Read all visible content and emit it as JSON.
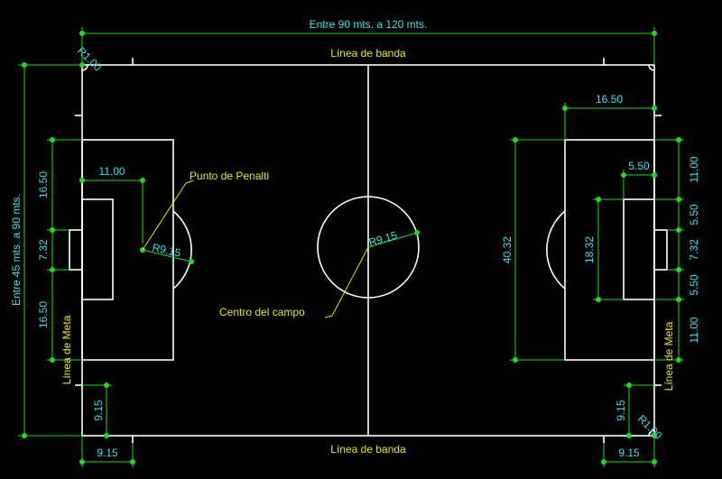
{
  "dimensions": {
    "length_range": "Entre 90 mts. a 120 mts.",
    "width_range": "Entre 45 mts. a 90 mts.",
    "penalty_area_depth": "16.50",
    "penalty_mark_distance": "11.00",
    "goal_width": "7.32",
    "goal_area_depth": "5.50",
    "goal_area_width": "18.32",
    "penalty_area_width": "40.32",
    "corner_radius": "R1.00",
    "arc_radius": "R9.15",
    "center_radius": "R9.15",
    "corner_distance": "9.15"
  },
  "labels": {
    "touchline": "Línea de banda",
    "goal_line": "Línea de Meta",
    "penalty_spot": "Punto de Penalti",
    "center": "Centro del campo"
  },
  "colors": {
    "background": "#000000",
    "field_lines": "#ffffff",
    "dimension_lines": "#18e018",
    "dimension_text": "#2ee6e6",
    "annotation_text": "#e8e800"
  }
}
